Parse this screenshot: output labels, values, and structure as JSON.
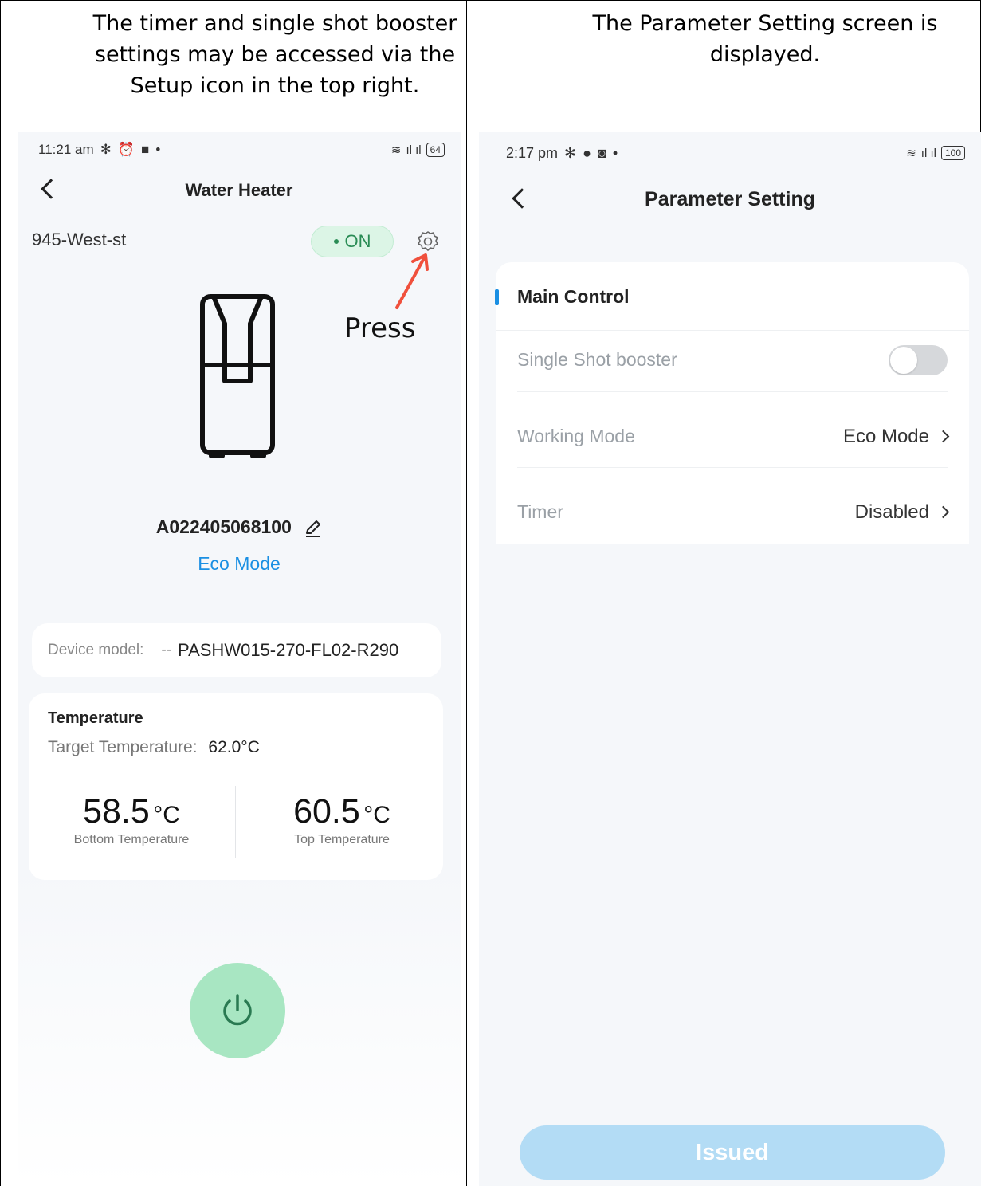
{
  "captions": {
    "left": "The timer and single shot booster settings may be accessed via the Setup icon in the top right.",
    "right": "The Parameter Setting screen is displayed."
  },
  "left_screen": {
    "status": {
      "time": "11:21 am",
      "battery": "64"
    },
    "title": "Water Heater",
    "location": "945-West-st",
    "status_badge": "ON",
    "annotation": "Press",
    "device_id": "A022405068100",
    "mode": "Eco Mode",
    "model_label": "Device model:",
    "model_dash": "--",
    "model_value": "PASHW015-270-FL02-R290",
    "temperature": {
      "heading": "Temperature",
      "target_label": "Target Temperature:",
      "target_value": "62.0°C",
      "bottom_value": "58.5",
      "bottom_unit": "°C",
      "bottom_label": "Bottom Temperature",
      "top_value": "60.5",
      "top_unit": "°C",
      "top_label": "Top Temperature"
    }
  },
  "right_screen": {
    "status": {
      "time": "2:17 pm",
      "battery": "100"
    },
    "title": "Parameter Setting",
    "section_title": "Main Control",
    "rows": [
      {
        "label": "Single Shot booster",
        "value": ""
      },
      {
        "label": "Working Mode",
        "value": "Eco Mode"
      },
      {
        "label": "Timer",
        "value": "Disabled"
      }
    ],
    "issued_label": "Issued"
  },
  "colors": {
    "accent_blue": "#1a8fe3",
    "on_green": "#2a8c55",
    "power_green": "#a8e6c2",
    "arrow_red": "#f0503c"
  },
  "toggle_state": false
}
